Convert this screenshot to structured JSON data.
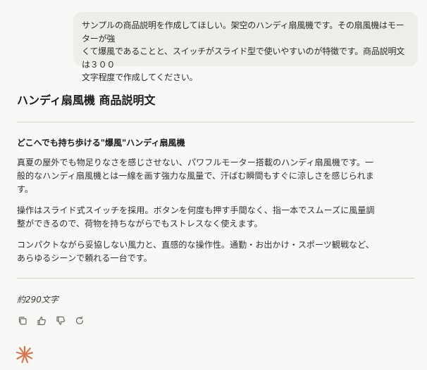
{
  "user_message": {
    "lines": [
      "サンプルの商品説明を作成してほしい。架空のハンディ扇風機です。その扇風機はモーターが強",
      "くて爆風であることと、スイッチがスライド型で使いやすいのが特徴です。商品説明文は３００",
      "文字程度で作成してください。"
    ]
  },
  "response": {
    "title": "ハンディ扇風機 商品説明文",
    "subheading": "どこへでも持ち歩ける\"爆風\"ハンディ扇風機",
    "paragraphs": [
      [
        "真夏の屋外でも物足りなさを感じさせない、パワフルモーター搭載のハンディ扇風機です。一",
        "般的なハンディ扇風機とは一線を画す強力な風量で、汗ばむ瞬間もすぐに涼しさを感じられま",
        "す。"
      ],
      [
        "操作はスライド式スイッチを採用。ボタンを何度も押す手間なく、指一本でスムーズに風量調",
        "整ができるので、荷物を持ちながらでもストレスなく使えます。"
      ],
      [
        "コンパクトながら妥協しない風力と、直感的な操作性。通勤・お出かけ・スポーツ観戦など、",
        "あらゆるシーンで頼れる一台です。"
      ]
    ],
    "char_count": "約290文字"
  },
  "actions": [
    {
      "name": "copy",
      "icon": "copy-icon"
    },
    {
      "name": "thumbs-up",
      "icon": "thumbs-up-icon"
    },
    {
      "name": "thumbs-down",
      "icon": "thumbs-down-icon"
    },
    {
      "name": "retry",
      "icon": "retry-icon"
    }
  ],
  "colors": {
    "background": "#f9f8f6",
    "user_bubble": "#efede8",
    "divider": "#d4d1ca",
    "icon": "#6b6963",
    "brand_logo": "#d97757"
  }
}
